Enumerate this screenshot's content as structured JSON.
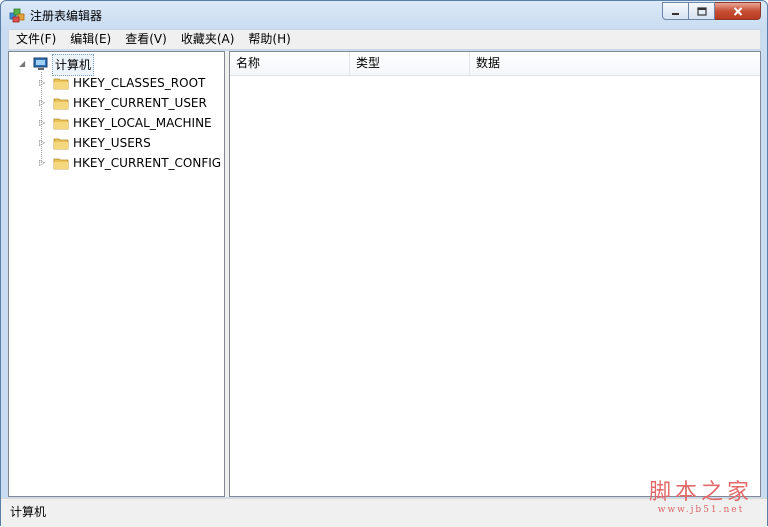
{
  "window": {
    "title": "注册表编辑器"
  },
  "menu": [
    "文件(F)",
    "编辑(E)",
    "查看(V)",
    "收藏夹(A)",
    "帮助(H)"
  ],
  "tree": {
    "root": "计算机",
    "children": [
      "HKEY_CLASSES_ROOT",
      "HKEY_CURRENT_USER",
      "HKEY_LOCAL_MACHINE",
      "HKEY_USERS",
      "HKEY_CURRENT_CONFIG"
    ]
  },
  "list": {
    "columns": [
      "名称",
      "类型",
      "数据"
    ]
  },
  "status": {
    "text": "计算机"
  },
  "watermark": {
    "main": "脚本之家",
    "sub": "www.jb51.net"
  },
  "colors": {
    "accent": "#5a7fa8",
    "close": "#c74f36",
    "folder": "#e9c25a"
  },
  "icons": {
    "app": "registry-icon",
    "computer": "computer-icon",
    "folder": "folder-icon"
  }
}
